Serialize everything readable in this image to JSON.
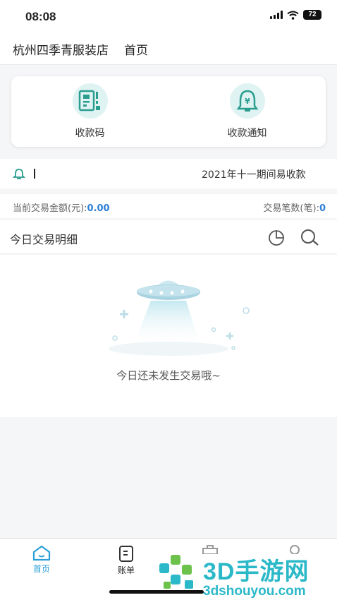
{
  "status_bar": {
    "time": "08:08",
    "battery": "72"
  },
  "header": {
    "store_name": "杭州四季青服装店",
    "page_title": "首页"
  },
  "quick_actions": [
    {
      "label": "收款码",
      "icon": "qr-code-icon"
    },
    {
      "label": "收款通知",
      "icon": "bell-yen-icon"
    }
  ],
  "notice": {
    "text": "2021年十一期间易收款",
    "icon": "announcement-icon"
  },
  "stats": {
    "amount_label": "当前交易金额(元):",
    "amount_value": "0.00",
    "count_label": "交易笔数(笔):",
    "count_value": "0"
  },
  "detail": {
    "title": "今日交易明细",
    "icons": [
      "pie-chart-icon",
      "search-icon"
    ]
  },
  "empty_state": {
    "text": "今日还未发生交易哦~",
    "icon": "ufo-illustration"
  },
  "tab_bar": {
    "active_color": "#2b9fd8",
    "items": [
      {
        "label": "首页",
        "icon": "home-icon",
        "active": true
      },
      {
        "label": "账单",
        "icon": "bill-icon",
        "active": false
      },
      {
        "label": "",
        "icon": "briefcase-icon",
        "active": false
      },
      {
        "label": "",
        "icon": "user-icon",
        "active": false
      }
    ]
  },
  "watermark": {
    "main": "3D手游网",
    "sub": "3dshouyou.com"
  }
}
